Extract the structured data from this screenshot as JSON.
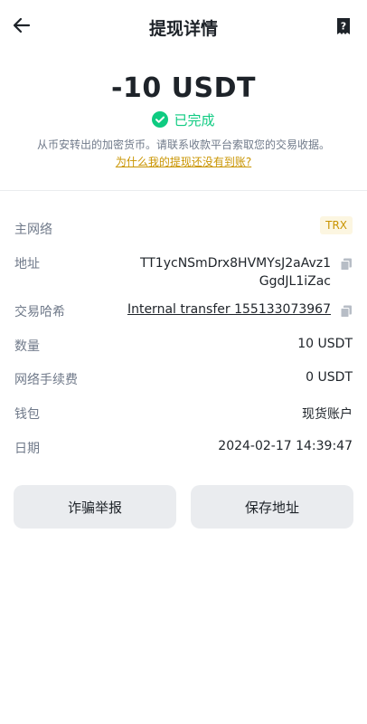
{
  "header": {
    "title": "提现详情",
    "back_icon": "arrow-left-icon",
    "help_icon": "help-doc-icon"
  },
  "summary": {
    "amount": "-10 USDT",
    "status": "已完成",
    "status_color": "#0ecb81",
    "note": "从币安转出的加密货币。请联系收款平台索取您的交易收据。",
    "help_link": "为什么我的提现还没有到账?"
  },
  "details": {
    "network": {
      "label": "主网络",
      "value": "TRX"
    },
    "address": {
      "label": "地址",
      "line1": "TT1ycNSmDrx8HVMYsJ2aAvz1",
      "line2": "GgdJL1iZac"
    },
    "txhash": {
      "label": "交易哈希",
      "value": "Internal transfer 155133073967"
    },
    "amount": {
      "label": "数量",
      "value": "10 USDT"
    },
    "fee": {
      "label": "网络手续费",
      "value": "0 USDT"
    },
    "wallet": {
      "label": "钱包",
      "value": "现货账户"
    },
    "date": {
      "label": "日期",
      "value": "2024-02-17 14:39:47"
    }
  },
  "actions": {
    "report": "诈骗举报",
    "save_address": "保存地址"
  },
  "colors": {
    "accent": "#c99400",
    "badge_bg": "#fcf6e1",
    "button_bg": "#eaecef"
  }
}
